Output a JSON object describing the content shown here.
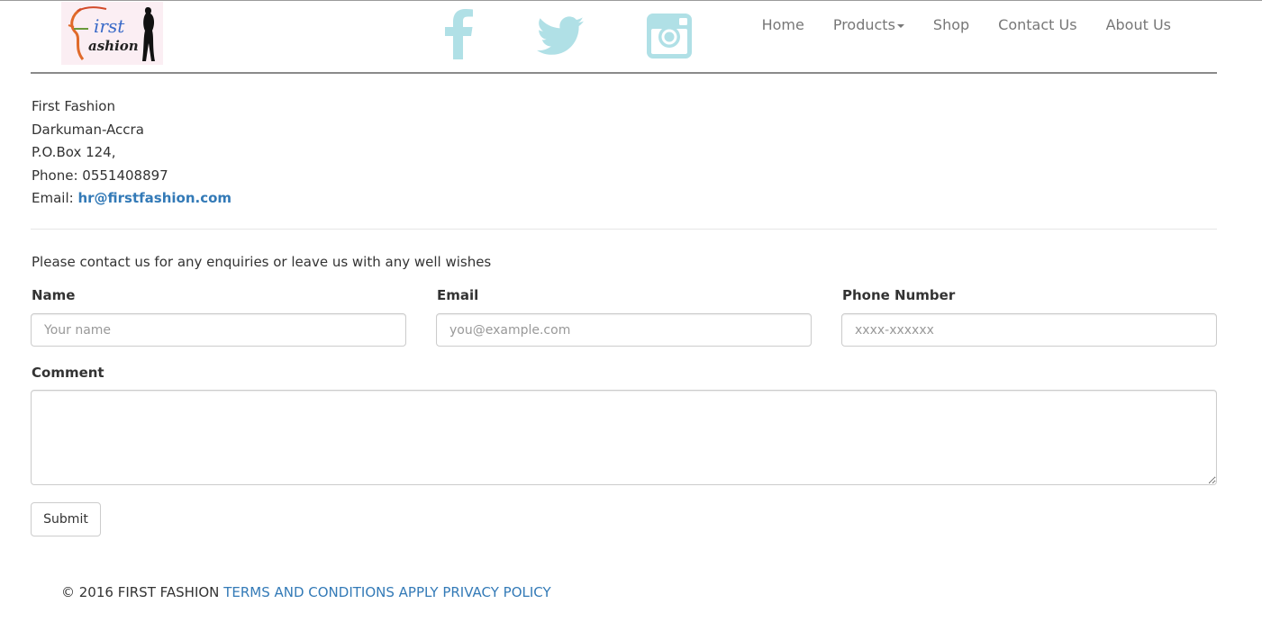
{
  "brand": {
    "logo_lines": [
      "irst",
      "ashion"
    ]
  },
  "colors": {
    "social_icon": "#b0e0e6",
    "nav_text": "#777777",
    "link": "#337ab7"
  },
  "social": [
    {
      "icon": "facebook-icon"
    },
    {
      "icon": "twitter-icon"
    },
    {
      "icon": "instagram-icon"
    }
  ],
  "nav": {
    "home": "Home",
    "products": "Products",
    "shop": "Shop",
    "contact": "Contact Us",
    "about": "About Us"
  },
  "address": {
    "company": "First Fashion",
    "location": "Darkuman-Accra",
    "pobox": "P.O.Box 124,",
    "phone": "Phone: 0551408897",
    "email_label": "Email:",
    "email": "hr@firstfashion.com"
  },
  "form": {
    "intro": "Please contact us for any enquiries or leave us with any well wishes",
    "name_label": "Name",
    "name_placeholder": "Your name",
    "email_label": "Email",
    "email_placeholder": "you@example.com",
    "phone_label": "Phone Number",
    "phone_placeholder": "xxxx-xxxxxx",
    "comment_label": "Comment",
    "submit": "Submit"
  },
  "footer": {
    "copyright": "© 2016 FIRST FASHION",
    "terms": "TERMS AND CONDITIONS APPLY",
    "privacy": "PRIVACY POLICY"
  }
}
